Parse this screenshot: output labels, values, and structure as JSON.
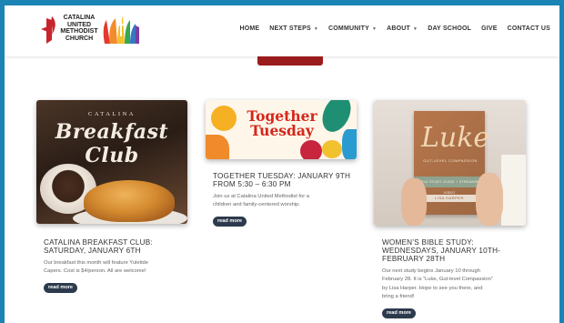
{
  "logo": {
    "lines": [
      "CATALINA",
      "UNITED",
      "METHODIST",
      "CHURCH"
    ]
  },
  "nav": {
    "items": [
      {
        "label": "HOME",
        "dropdown": false
      },
      {
        "label": "NEXT STEPS",
        "dropdown": true
      },
      {
        "label": "COMMUNITY",
        "dropdown": true
      },
      {
        "label": "ABOUT",
        "dropdown": true
      },
      {
        "label": "DAY SCHOOL",
        "dropdown": false
      },
      {
        "label": "GIVE",
        "dropdown": false
      },
      {
        "label": "CONTACT US",
        "dropdown": false
      }
    ]
  },
  "cards": [
    {
      "image": {
        "top_word": "CATALINA",
        "script": "Breakfast Club"
      },
      "title_line1": "CATALINA BREAKFAST CLUB:",
      "title_line2": "SATURDAY, JANUARY 6TH",
      "body_line1": "Our breakfast this month will feature Yuletide",
      "body_line2": "Capers. Cost is $4/person.  All are welcome!",
      "button": "read more"
    },
    {
      "image": {
        "line1": "Together",
        "line2": "Tuesday"
      },
      "title_line1": "TOGETHER TUESDAY: JANUARY 9TH",
      "title_line2": "FROM 5:30 – 6:30 PM",
      "body_line1": "Join us at Catalina United Methodist for a",
      "body_line2": "children and family-centered worship.",
      "button": "read more"
    },
    {
      "image": {
        "title": "Luke",
        "subtitle": "GUT-LEVEL COMPASSION",
        "band": "BIBLE STUDY GUIDE + STREAMING VIDEO",
        "author": "LISA HARPER"
      },
      "title_line1": "WOMEN’S BIBLE STUDY:",
      "title_line2": "WEDNESDAYS, JANUARY 10TH-",
      "title_line3": "FEBRUARY 28TH",
      "body_line1": "Our next study begins January 10 through",
      "body_line2": "February 28. It is “Luke, Gut-level Compassion”",
      "body_line3": "by Lisa Harper. Hope to see you there, and",
      "body_line4": "bring a friend!",
      "button": "read more"
    }
  ],
  "colors": {
    "frame": "#1b84b5",
    "button": "#2d3a4d",
    "accent_red": "#9b1c1c"
  }
}
